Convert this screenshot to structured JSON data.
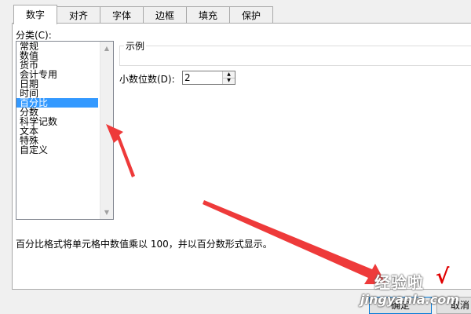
{
  "tabs": [
    {
      "label": "数字",
      "active": true
    },
    {
      "label": "对齐",
      "active": false
    },
    {
      "label": "字体",
      "active": false
    },
    {
      "label": "边框",
      "active": false
    },
    {
      "label": "填充",
      "active": false
    },
    {
      "label": "保护",
      "active": false
    }
  ],
  "category": {
    "label": "分类(C):",
    "items": [
      "常规",
      "数值",
      "货币",
      "会计专用",
      "日期",
      "时间",
      "百分比",
      "分数",
      "科学记数",
      "文本",
      "特殊",
      "自定义"
    ],
    "selected": "百分比"
  },
  "sample": {
    "label": "示例",
    "value": ""
  },
  "decimal_places": {
    "label": "小数位数(D):",
    "value": "2"
  },
  "description": "百分比格式将单元格中数值乘以 100，并以百分数形式显示。",
  "buttons": {
    "ok": "确定",
    "cancel": "取消"
  },
  "watermark": {
    "text": "经验啦",
    "check": "√",
    "url": "jingyanla.com"
  },
  "colors": {
    "arrow": "#ee3a3a",
    "selection": "#3399ff",
    "check": "#e00000"
  }
}
